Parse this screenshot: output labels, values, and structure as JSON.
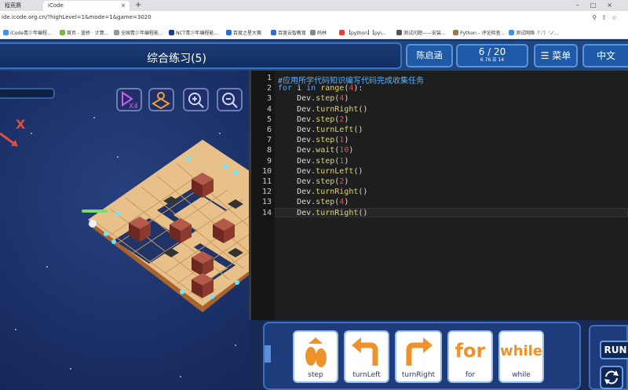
{
  "browser": {
    "tabs": [
      {
        "label": "程竞赛"
      },
      {
        "label": "iCode",
        "close": "×"
      }
    ],
    "new_tab": "+",
    "window_controls": "–□×",
    "url": "ide.icode.org.cn/?highLevel=1&mode=1&game=3020",
    "bookmarks": [
      {
        "label": "iCode青少年编程...",
        "color": "#4a90e2"
      },
      {
        "label": "首页 - 蓝桥 · 计算...",
        "color": "#7ab648"
      },
      {
        "label": "全国青少年编程能...",
        "color": "#999999"
      },
      {
        "label": "NCT青少年编程能...",
        "color": "#1d3d8f"
      },
      {
        "label": "百度之星大赛",
        "color": "#2a6dd6"
      },
      {
        "label": "百度云智教育",
        "color": "#2a6dd6"
      },
      {
        "label": "码林",
        "color": "#888888"
      },
      {
        "label": "【python】【py\\...",
        "color": "#e04040"
      },
      {
        "label": "测试问题——安装...",
        "color": "#555555"
      },
      {
        "label": "Python – 评论检查...",
        "color": "#9a7a40"
      },
      {
        "label": "测试网络（'-'）'ノ...",
        "color": "#4a90e2"
      }
    ]
  },
  "header": {
    "title": "综合练习(5)",
    "user_name": "陈启涵",
    "level": "6 / 20",
    "level_stats": "6 76    ☰ 14",
    "menu_label": "☰ 菜单",
    "lang_label": "中文"
  },
  "scene": {
    "target_marker": "X",
    "tools": [
      "speed-x4",
      "map",
      "zoom-in",
      "zoom-out"
    ],
    "speed_label": "X4"
  },
  "editor": {
    "lines": [
      {
        "n": "1",
        "html": "<span class=\"cm\">#应用所学代码知识编写代码完成收集任务</span>"
      },
      {
        "n": "2",
        "html": "<span class=\"kw\">for</span> i <span class=\"kw\">in</span> <span class=\"fn\">range</span>(<span class=\"num\">4</span>):"
      },
      {
        "n": "3",
        "html": "    Dev.<span class=\"fn\">step</span>(<span class=\"num\">4</span>)"
      },
      {
        "n": "4",
        "html": "    Dev.<span class=\"fn\">turnRight</span>()"
      },
      {
        "n": "5",
        "html": "    Dev.<span class=\"fn\">step</span>(<span class=\"num\">2</span>)"
      },
      {
        "n": "6",
        "html": "    Dev.<span class=\"fn\">turnLeft</span>()"
      },
      {
        "n": "7",
        "html": "    Dev.<span class=\"fn\">step</span>(<span class=\"num\">1</span>)"
      },
      {
        "n": "8",
        "html": "    Dev.<span class=\"fn\">wait</span>(<span class=\"num\">10</span>)"
      },
      {
        "n": "9",
        "html": "    Dev.<span class=\"fn\">step</span>(<span class=\"num\">1</span>)"
      },
      {
        "n": "10",
        "html": "    Dev.<span class=\"fn\">turnLeft</span>()"
      },
      {
        "n": "11",
        "html": "    Dev.<span class=\"fn\">step</span>(<span class=\"num\">2</span>)"
      },
      {
        "n": "12",
        "html": "    Dev.<span class=\"fn\">turnRight</span>()"
      },
      {
        "n": "13",
        "html": "    Dev.<span class=\"fn\">step</span>(<span class=\"num\">4</span>)"
      },
      {
        "n": "14",
        "html": "    Dev.<span class=\"fn\">turnRight</span>()"
      }
    ],
    "current_line": "14"
  },
  "toolbox": {
    "blocks": [
      {
        "id": "step",
        "label": "step"
      },
      {
        "id": "turnleft",
        "label": "turnLeft"
      },
      {
        "id": "turnright",
        "label": "turnRight"
      },
      {
        "id": "for",
        "label": "for",
        "glyph": "for"
      },
      {
        "id": "while",
        "label": "while",
        "glyph": "while"
      }
    ],
    "run_label": "RUN"
  },
  "colors": {
    "accent": "#1f5aa8",
    "editor_bg": "#1e1e1e",
    "block_orange": "#f0922b"
  }
}
